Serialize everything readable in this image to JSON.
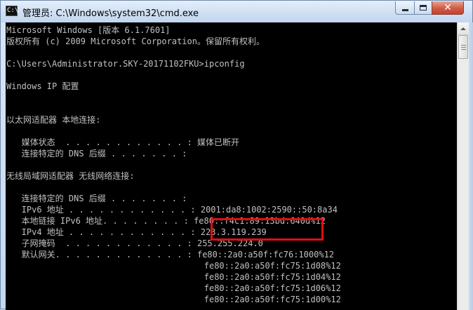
{
  "window": {
    "title": "管理员: C:\\Windows\\system32\\cmd.exe",
    "icon_glyph": "C:\\",
    "close_glyph": "✕"
  },
  "console": {
    "lines": [
      "Microsoft Windows [版本 6.1.7601]",
      "版权所有 (c) 2009 Microsoft Corporation。保留所有权利。",
      "",
      "C:\\Users\\Administrator.SKY-20171102FKU>ipconfig",
      "",
      "Windows IP 配置",
      "",
      "",
      "以太网适配器 本地连接:",
      "",
      "   媒体状态  . . . . . . . . . . . . : 媒体已断开",
      "   连接特定的 DNS 后缀 . . . . . . . :",
      "",
      "无线局域网适配器 无线网络连接:",
      "",
      "   连接特定的 DNS 后缀 . . . . . . . :",
      "   IPv6 地址 . . . . . . . . . . . . : 2001:da8:1002:2590::50:8a34",
      "   本地链接 IPv6 地址. . . . . . . . : fe80::f4c1:89:13bd:640d%12",
      "   IPv4 地址 . . . . . . . . . . . . : 223.3.119.239",
      "   子网掩码  . . . . . . . . . . . . : 255.255.224.0",
      "   默认网关. . . . . . . . . . . . . : fe80::2a0:a50f:fc76:1000%12",
      "                                       fe80::2a0:a50f:fc75:1d08%12",
      "                                       fe80::2a0:a50f:fc75:1d04%12",
      "                                       fe80::2a0:a50f:fc75:1d06%12",
      "                                       fe80::2a0:a50f:fc75:1d00%12"
    ]
  },
  "colors": {
    "console_bg": "#000000",
    "console_text": "#c0c0c0",
    "highlight": "#e01010"
  }
}
